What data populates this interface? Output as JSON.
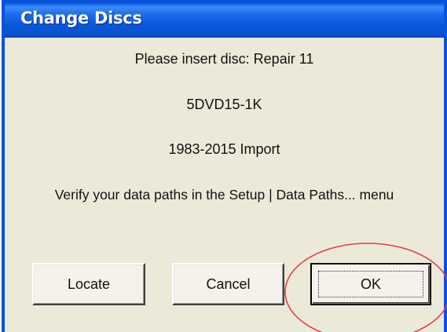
{
  "window": {
    "title": "Change Discs"
  },
  "message": {
    "line1": "Please insert disc: Repair 11",
    "line2": "5DVD15-1K",
    "line3": "1983-2015 Import",
    "line4": "Verify your data paths in the Setup | Data Paths... menu"
  },
  "buttons": {
    "locate": "Locate",
    "cancel": "Cancel",
    "ok": "OK"
  },
  "colors": {
    "titlebar": "#0a52d8",
    "dialog_background": "#ece9d8",
    "annotation_circle": "#e0404a"
  }
}
